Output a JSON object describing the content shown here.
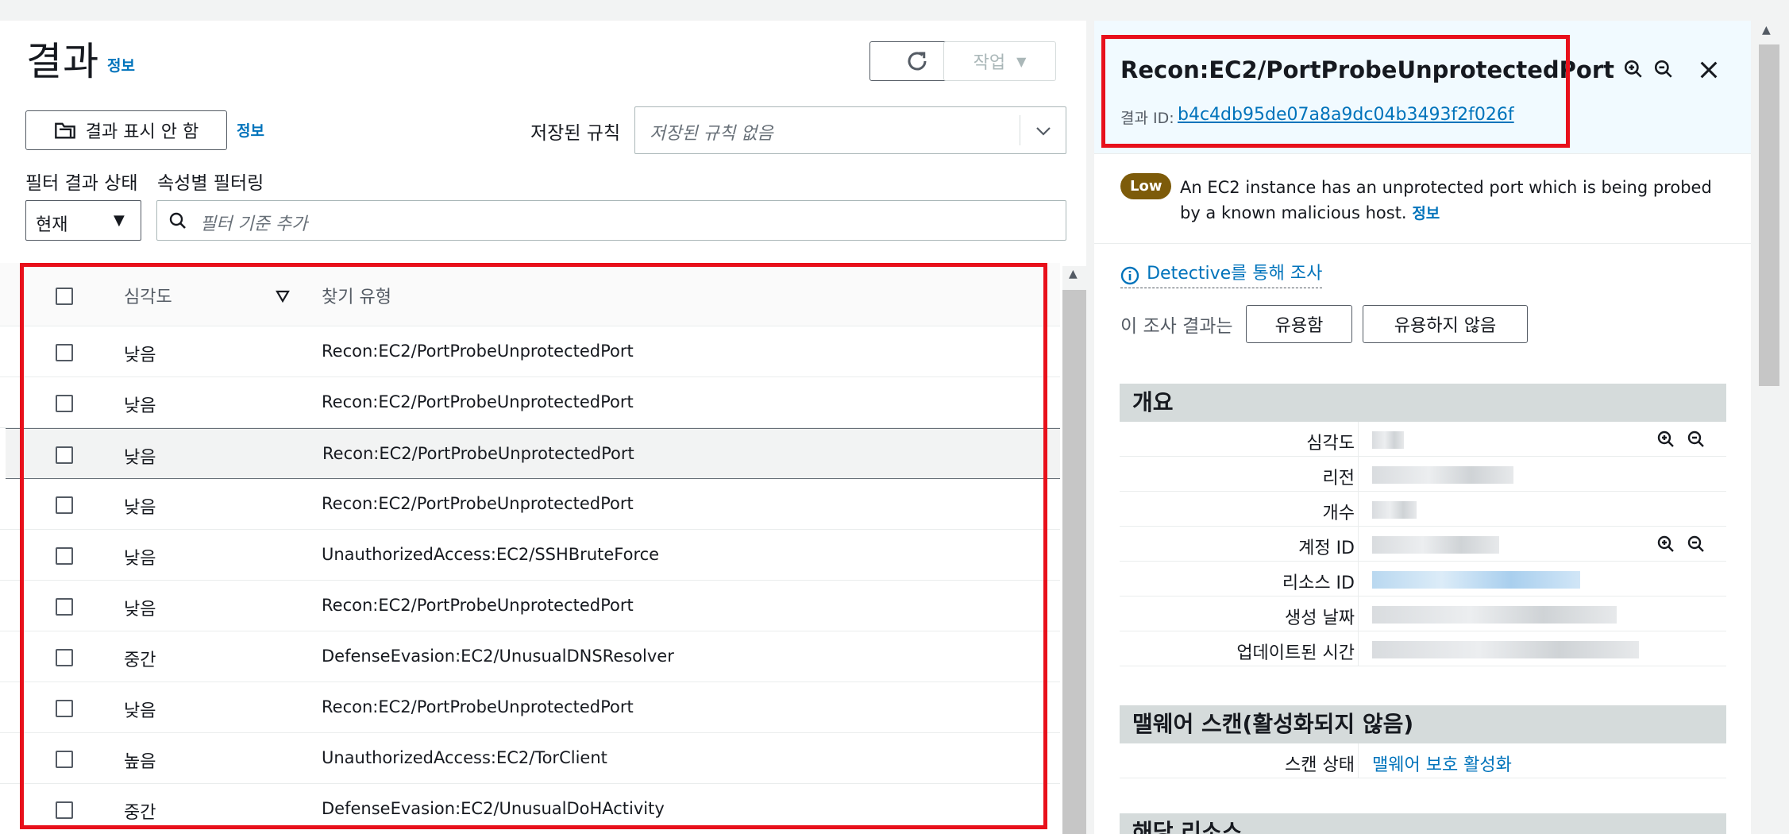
{
  "left": {
    "title": "결과",
    "info": "정보",
    "action_label": "작업",
    "suppress_button": "결과 표시 안 함",
    "suppress_info": "정보",
    "saved_rules_label": "저장된 규칙",
    "saved_rules_placeholder": "저장된 규칙 없음",
    "filter_status_label": "필터 결과 상태",
    "filter_status_value": "현재",
    "attr_filter_label": "속성별 필터링",
    "attr_filter_placeholder": "필터 기준 추가",
    "table": {
      "headers": {
        "severity": "심각도",
        "type": "찾기 유형"
      },
      "rows": [
        {
          "severity": "낮음",
          "type": "Recon:EC2/PortProbeUnprotectedPort"
        },
        {
          "severity": "낮음",
          "type": "Recon:EC2/PortProbeUnprotectedPort"
        },
        {
          "severity": "낮음",
          "type": "Recon:EC2/PortProbeUnprotectedPort"
        },
        {
          "severity": "낮음",
          "type": "Recon:EC2/PortProbeUnprotectedPort"
        },
        {
          "severity": "낮음",
          "type": "UnauthorizedAccess:EC2/SSHBruteForce"
        },
        {
          "severity": "낮음",
          "type": "Recon:EC2/PortProbeUnprotectedPort"
        },
        {
          "severity": "중간",
          "type": "DefenseEvasion:EC2/UnusualDNSResolver"
        },
        {
          "severity": "낮음",
          "type": "Recon:EC2/PortProbeUnprotectedPort"
        },
        {
          "severity": "높음",
          "type": "UnauthorizedAccess:EC2/TorClient"
        },
        {
          "severity": "중간",
          "type": "DefenseEvasion:EC2/UnusualDoHActivity"
        }
      ]
    }
  },
  "right": {
    "title": "Recon:EC2/PortProbeUnprotectedPort",
    "finding_id_label": "결과 ID:",
    "finding_id": "b4c4db95de07a8a9dc04b3493f2f026f",
    "badge": "Low",
    "description": "An EC2 instance has an unprotected port which is being probed by a known malicious host.",
    "description_info": "정보",
    "detective_link": "Detective를 통해 조사",
    "feedback_label": "이 조사 결과는",
    "useful_button": "유용함",
    "not_useful_button": "유용하지 않음",
    "overview": {
      "heading": "개요",
      "fields": [
        {
          "key": "심각도"
        },
        {
          "key": "리전"
        },
        {
          "key": "개수"
        },
        {
          "key": "계정 ID"
        },
        {
          "key": "리소스 ID"
        },
        {
          "key": "생성 날짜"
        },
        {
          "key": "업데이트된 시간"
        }
      ]
    },
    "malware": {
      "heading": "맬웨어 스캔(활성화되지 않음)",
      "scan_status_key": "스캔 상태",
      "scan_status_link": "맬웨어 보호 활성화"
    },
    "resource_heading": "해당 리소스"
  },
  "colors": {
    "highlight_red": "#e8101b",
    "link_blue": "#0073bb",
    "low_badge": "#7d5b0a"
  }
}
